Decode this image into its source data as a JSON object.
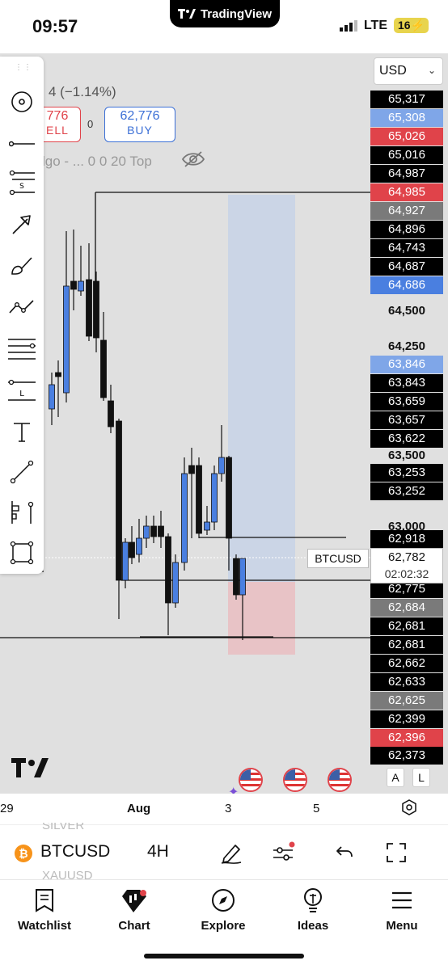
{
  "status": {
    "time": "09:57",
    "app_badge": "TradingView",
    "network": "LTE",
    "battery": "16"
  },
  "header": {
    "change_text": "4 (−1.14%)",
    "sell_price": "776",
    "sell_label": "ELL",
    "spread": "0",
    "buy_price": "62,776",
    "buy_label": "BUY",
    "indicator_text": "lgo - ... 0 0 20 Top",
    "currency": "USD"
  },
  "price_labels": [
    {
      "text": "65,317",
      "bg": "#000000"
    },
    {
      "text": "65,308",
      "bg": "#7fa6e8"
    },
    {
      "text": "65,026",
      "bg": "#e0434a"
    },
    {
      "text": "65,016",
      "bg": "#000000"
    },
    {
      "text": "64,987",
      "bg": "#000000"
    },
    {
      "text": "64,985",
      "bg": "#e0434a"
    },
    {
      "text": "64,927",
      "bg": "#7a7a7a"
    },
    {
      "text": "64,896",
      "bg": "#000000"
    },
    {
      "text": "64,743",
      "bg": "#000000"
    },
    {
      "text": "64,687",
      "bg": "#000000"
    },
    {
      "text": "64,686",
      "bg": "#4a7fe0"
    },
    {
      "text": "64,500",
      "bg": "plain"
    },
    {
      "text": "64,250",
      "bg": "plain"
    },
    {
      "text": "63,846",
      "bg": "#7fa6e8"
    },
    {
      "text": "63,843",
      "bg": "#000000"
    },
    {
      "text": "63,659",
      "bg": "#000000"
    },
    {
      "text": "63,657",
      "bg": "#000000"
    },
    {
      "text": "63,622",
      "bg": "#000000"
    },
    {
      "text": "63,500",
      "bg": "plain"
    },
    {
      "text": "63,253",
      "bg": "#000000"
    },
    {
      "text": "63,252",
      "bg": "#000000"
    },
    {
      "text": "63,000",
      "bg": "plain"
    },
    {
      "text": "62,918",
      "bg": "#000000"
    },
    {
      "text": "62,775",
      "bg": "#000000"
    },
    {
      "text": "62,684",
      "bg": "#7a7a7a"
    },
    {
      "text": "62,681",
      "bg": "#000000"
    },
    {
      "text": "62,681",
      "bg": "#000000"
    },
    {
      "text": "62,662",
      "bg": "#000000"
    },
    {
      "text": "62,633",
      "bg": "#000000"
    },
    {
      "text": "62,625",
      "bg": "#7a7a7a"
    },
    {
      "text": "62,399",
      "bg": "#000000"
    },
    {
      "text": "62,396",
      "bg": "#e0434a"
    },
    {
      "text": "62,373",
      "bg": "#000000"
    }
  ],
  "live": {
    "symbol": "BTCUSD",
    "price": "62,782",
    "countdown": "02:02:32"
  },
  "time_axis": [
    "29",
    "Aug",
    "3",
    "5"
  ],
  "scale_buttons": {
    "auto": "A",
    "log": "L"
  },
  "symbol_bar": {
    "ghost_above": "SILVER",
    "ghost_below": "XAUUSD",
    "symbol": "BTCUSD",
    "interval": "4H",
    "coin_glyph": "₿"
  },
  "nav": [
    {
      "label": "Watchlist",
      "icon": "watchlist-icon"
    },
    {
      "label": "Chart",
      "icon": "chart-icon"
    },
    {
      "label": "Explore",
      "icon": "compass-icon"
    },
    {
      "label": "Ideas",
      "icon": "bulb-icon"
    },
    {
      "label": "Menu",
      "icon": "menu-icon"
    }
  ],
  "colors": {
    "up": "#4a7fe0",
    "down": "#111111",
    "sell": "#e0434a",
    "buy": "#3b6fd6"
  }
}
